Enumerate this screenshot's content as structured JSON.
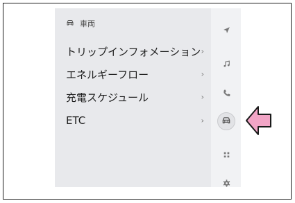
{
  "section": {
    "icon": "car-icon",
    "title": "車両"
  },
  "menu": {
    "items": [
      {
        "label": "トリップインフォメーション",
        "chevron": "›"
      },
      {
        "label": "エネルギーフロー",
        "chevron": "›"
      },
      {
        "label": "充電スケジュール",
        "chevron": "›"
      },
      {
        "label": "ETC",
        "chevron": "›"
      }
    ]
  },
  "rail": {
    "icons": [
      "navigation-icon",
      "music-icon",
      "phone-icon",
      "car-icon",
      "apps-grid-icon",
      "settings-gear-icon"
    ],
    "active_index": 3
  },
  "colors": {
    "panel_bg": "#e8e9ec",
    "rail_bg": "#f1f2f4",
    "icon_gray": "#777777",
    "arrow_fill": "#f2a5c6",
    "arrow_stroke": "#1a1a1a"
  }
}
